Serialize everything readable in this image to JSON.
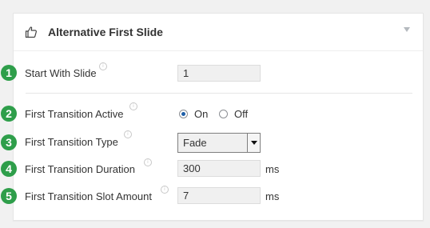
{
  "panel": {
    "title": "Alternative First Slide",
    "header_icon": "thumbs-up-icon",
    "toggle_icon": "collapse-arrow-icon"
  },
  "fields": {
    "start_with_slide": {
      "step": "1",
      "label": "Start With Slide",
      "value": "1"
    },
    "transition_active": {
      "step": "2",
      "label": "First Transition Active",
      "option_on": "On",
      "option_off": "Off",
      "selected": "On"
    },
    "transition_type": {
      "step": "3",
      "label": "First Transition Type",
      "value": "Fade"
    },
    "transition_duration": {
      "step": "4",
      "label": "First Transition Duration",
      "value": "300",
      "unit": "ms"
    },
    "slot_amount": {
      "step": "5",
      "label": "First Transition Slot Amount",
      "value": "7",
      "unit": "ms"
    }
  },
  "info_icon": "i",
  "colors": {
    "badge": "#2e9e4a",
    "radio_selected": "#1e5fa8"
  }
}
